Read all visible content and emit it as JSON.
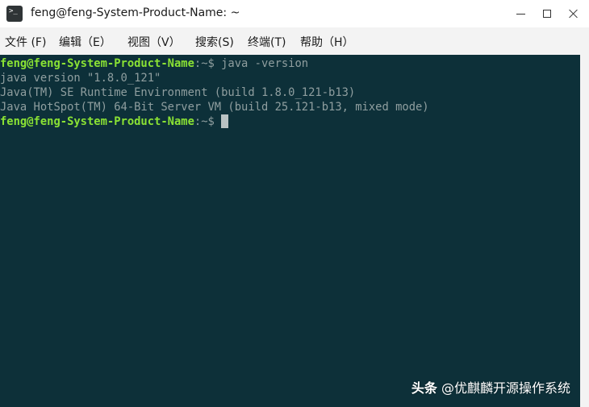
{
  "window": {
    "title": "feng@feng-System-Product-Name: ~",
    "app_icon": "terminal-icon",
    "controls": [
      "minimize-icon",
      "maximize-icon",
      "close-icon"
    ]
  },
  "menu": {
    "items": [
      "文件 (F)",
      "编辑（E）",
      "视图（V）",
      "搜索(S)",
      "终端(T)",
      "帮助（H）"
    ]
  },
  "terminal": {
    "colors": {
      "background": "#0d3039",
      "text": "#8f9e9f",
      "user_host": "#8ae234"
    },
    "prompt_user_host": "feng@feng-System-Product-Name",
    "prompt_suffix": ":~$",
    "command": " java -version",
    "output": [
      "java version \"1.8.0_121\"",
      "Java(TM) SE Runtime Environment (build 1.8.0_121-b13)",
      "Java HotSpot(TM) 64-Bit Server VM (build 25.121-b13, mixed mode)"
    ]
  },
  "watermark": {
    "brand": "头条",
    "account": " @优麒麟开源操作系统"
  }
}
